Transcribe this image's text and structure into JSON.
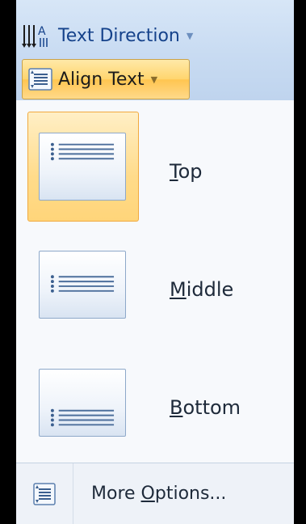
{
  "ribbon": {
    "text_direction_label": "Text Direction",
    "text_direction_icon_glyph": "A",
    "align_text_label": "Align Text",
    "caret_glyph": "▼"
  },
  "menu": {
    "items": [
      {
        "id": "top",
        "label_underlined": "T",
        "label_rest": "op",
        "selected": true
      },
      {
        "id": "middle",
        "label_underlined": "M",
        "label_rest": "iddle",
        "selected": false
      },
      {
        "id": "bottom",
        "label_underlined": "B",
        "label_rest": "ottom",
        "selected": false
      }
    ],
    "more_options": {
      "label_prefix": "More ",
      "label_underlined": "O",
      "label_rest": "ptions..."
    }
  },
  "colors": {
    "accent": "#ffd56e",
    "ribbon": "#c8dbf2",
    "tile_border": "#8da8c9",
    "text_link": "#15428b"
  },
  "icons": [
    "text-direction-icon",
    "align-text-icon",
    "align-top-icon",
    "align-middle-icon",
    "align-bottom-icon",
    "more-options-icon"
  ]
}
